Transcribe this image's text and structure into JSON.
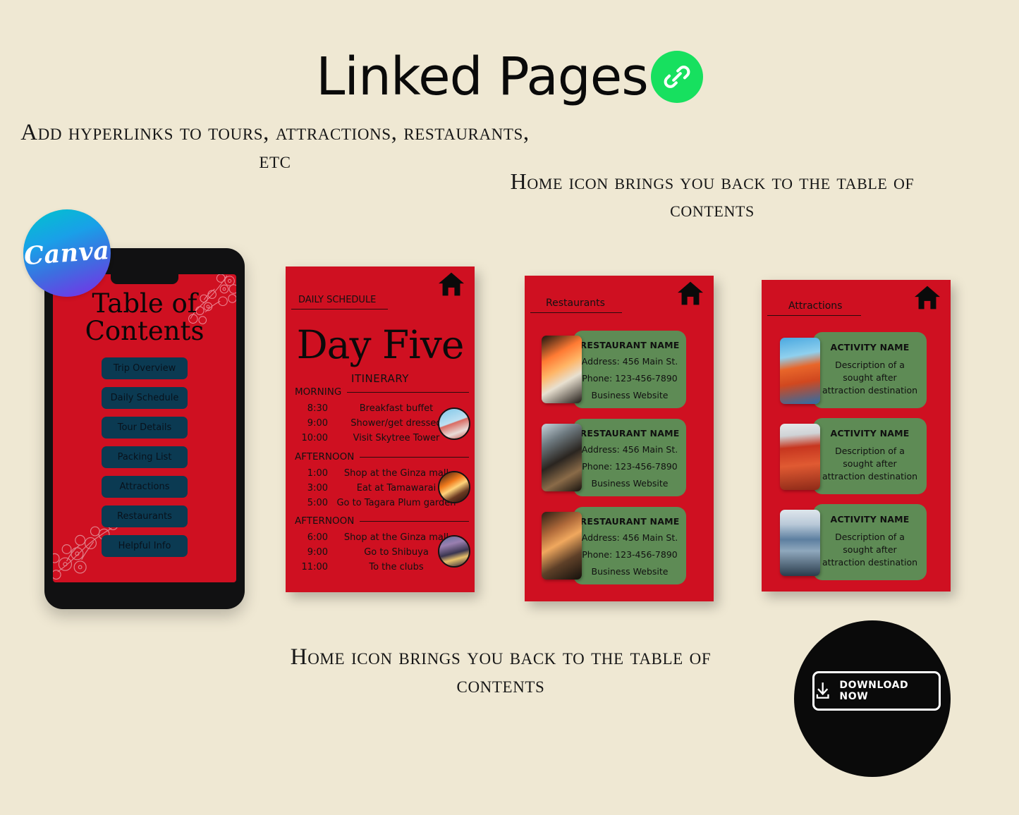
{
  "header": {
    "title": "Linked Pages",
    "link_icon": "link-chain-icon",
    "accent_green": "#17e05f"
  },
  "captions": {
    "left": "Add hyperlinks to tours, attractions, restaurants, etc",
    "right": "Home icon brings you back to the table of contents",
    "bottom": "Home icon brings you back to the table of contents"
  },
  "canva_badge": {
    "label": "Canva"
  },
  "colors": {
    "background": "#efe8d3",
    "page_red": "#cf1021",
    "card_green": "#5e8b55",
    "button_navy": "#0b3a52",
    "black": "#0a0a0a"
  },
  "tablet": {
    "title_line1": "Table of",
    "title_line2": "Contents",
    "buttons": [
      "Trip Overview",
      "Daily Schedule",
      "Tour Details",
      "Packing List",
      "Attractions",
      "Restaurants",
      "Helpful Info"
    ]
  },
  "schedule_panel": {
    "kicker": "DAILY SCHEDULE",
    "home_icon": "home-icon",
    "day_title": "Day Five",
    "itinerary_label": "ITINERARY",
    "sections": [
      {
        "label": "MORNING",
        "rows": [
          {
            "time": "8:30",
            "activity": "Breakfast buffet"
          },
          {
            "time": "9:00",
            "activity": "Shower/get dressed"
          },
          {
            "time": "10:00",
            "activity": "Visit Skytree Tower"
          }
        ],
        "thumb": "tokyo-tower-photo"
      },
      {
        "label": "AFTERNOON",
        "rows": [
          {
            "time": "1:00",
            "activity": "Shop at the Ginza mall"
          },
          {
            "time": "3:00",
            "activity": "Eat at Tamawarai"
          },
          {
            "time": "5:00",
            "activity": "Go to Tagara Plum garden"
          }
        ],
        "thumb": "lantern-street-photo"
      },
      {
        "label": "AFTERNOON",
        "rows": [
          {
            "time": "6:00",
            "activity": "Shop at the Ginza mall"
          },
          {
            "time": "9:00",
            "activity": "Go to Shibuya"
          },
          {
            "time": "11:00",
            "activity": "To the clubs"
          }
        ],
        "thumb": "shibuya-night-photo"
      }
    ]
  },
  "restaurants_panel": {
    "kicker": "Restaurants",
    "home_icon": "home-icon",
    "cards": [
      {
        "name": "RESTAURANT NAME",
        "address": "Address: 456 Main St.",
        "phone": "Phone: 123-456-7890",
        "website": "Business Website",
        "image": "sushi-platter-photo"
      },
      {
        "name": "RESTAURANT NAME",
        "address": "Address: 456 Main St.",
        "phone": "Phone: 123-456-7890",
        "website": "Business Website",
        "image": "hotpot-dining-photo"
      },
      {
        "name": "RESTAURANT NAME",
        "address": "Address: 456 Main St.",
        "phone": "Phone: 123-456-7890",
        "website": "Business Website",
        "image": "shared-meal-photo"
      }
    ]
  },
  "attractions_panel": {
    "kicker": "Attractions",
    "home_icon": "home-icon",
    "cards": [
      {
        "name": "ACTIVITY NAME",
        "description": "Description of a sought after attraction destination",
        "image": "torii-gate-photo"
      },
      {
        "name": "ACTIVITY NAME",
        "description": "Description of a sought after attraction destination",
        "image": "red-temple-photo"
      },
      {
        "name": "ACTIVITY NAME",
        "description": "Description of a sought after attraction destination",
        "image": "mount-fuji-photo"
      }
    ]
  },
  "download": {
    "label": "DOWNLOAD NOW",
    "icon": "download-arrow-icon"
  }
}
